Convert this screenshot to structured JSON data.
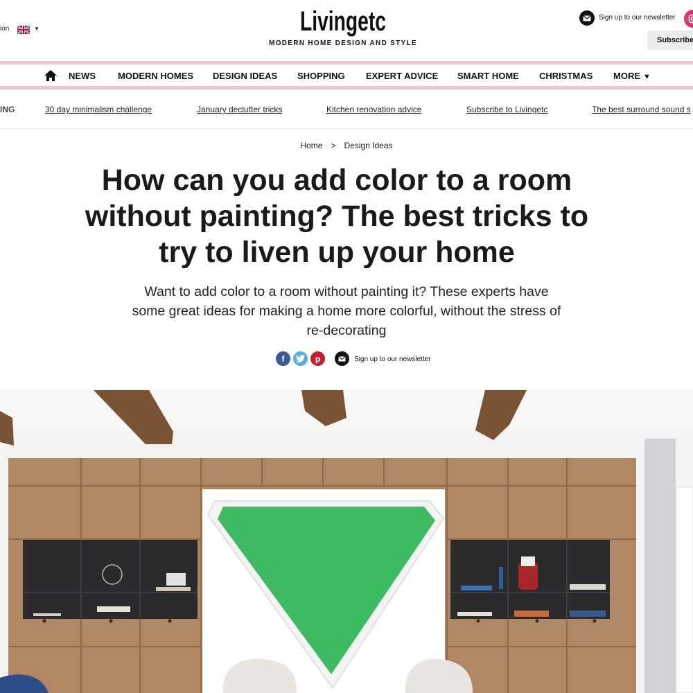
{
  "header": {
    "edition_fragment": "ion",
    "logo_text": "Livingetc",
    "tagline": "MODERN HOME DESIGN AND STYLE",
    "newsletter_label": "Sign up to our newsletter",
    "subscribe_label": "Subscribe"
  },
  "nav": {
    "items": [
      "NEWS",
      "MODERN HOMES",
      "DESIGN IDEAS",
      "SHOPPING",
      "EXPERT ADVICE",
      "SMART HOME",
      "CHRISTMAS",
      "MORE"
    ],
    "more_caret": "▼"
  },
  "trending": {
    "label": "ING",
    "links": [
      "30 day minimalism challenge",
      "January declutter tricks",
      "Kitchen renovation advice",
      "Subscribe to Livingetc",
      "The best surround sound s"
    ]
  },
  "breadcrumb": {
    "home": "Home",
    "separator": ">",
    "section": "Design Ideas"
  },
  "article": {
    "headline": "How can you add color to a room without painting? The best tricks to try to liven up your home",
    "standfirst": "Want to add color to a room without painting it? These experts have some great ideas for making a home more colorful, without the stress of re-decorating",
    "share": {
      "facebook_glyph": "f",
      "twitter_glyph": "t",
      "pinterest_glyph": "p",
      "newsletter_label": "Sign up to our newsletter"
    }
  },
  "colors": {
    "nav_rule": "#e6c5cc",
    "facebook": "#3b5a9a",
    "twitter": "#55acee",
    "pinterest": "#c41f2f",
    "artwork_green": "#3dba62"
  }
}
